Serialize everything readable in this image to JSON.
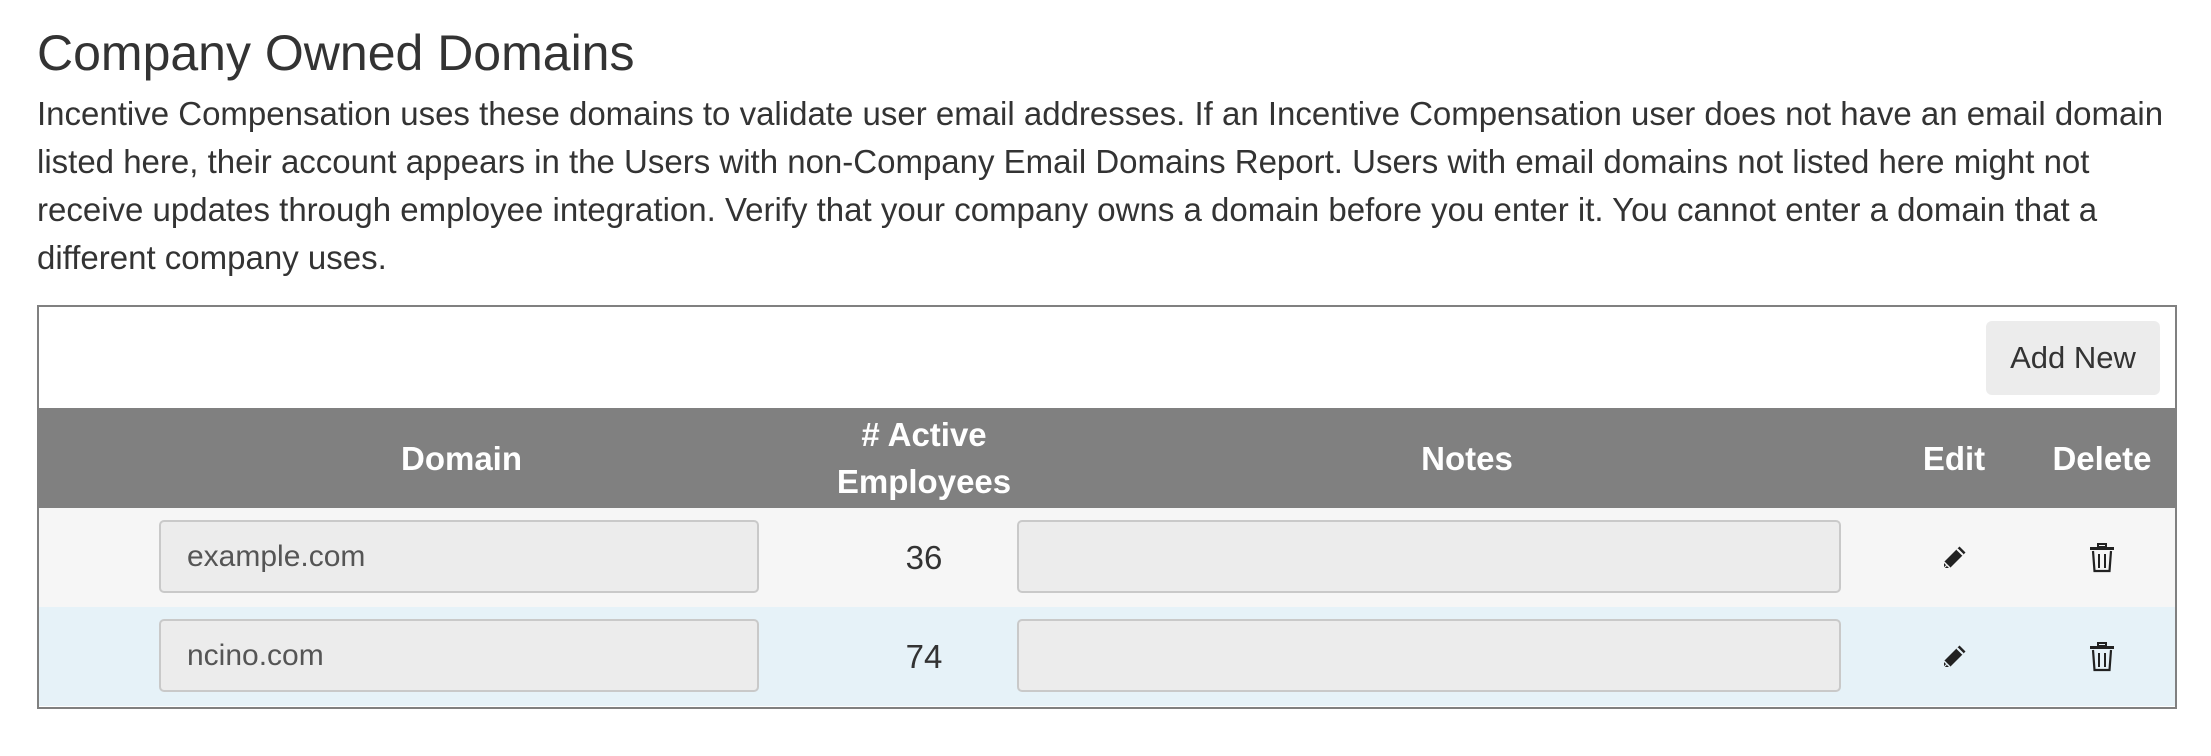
{
  "page": {
    "title": "Company Owned Domains",
    "description": "Incentive Compensation uses these domains to validate user email addresses. If an Incentive Compensation user does not have an email domain listed here, their account appears in the Users with non-Company Email Domains Report. Users with email domains not listed here might not receive updates through employee integration. Verify that your company owns a domain before you enter it. You cannot enter a domain that a different company uses."
  },
  "toolbar": {
    "add_new_label": "Add New"
  },
  "table": {
    "columns": {
      "domain": "Domain",
      "active_line1": "# Active",
      "active_line2": "Employees",
      "notes": "Notes",
      "edit": "Edit",
      "delete": "Delete"
    },
    "rows": [
      {
        "domain": "example.com",
        "active_employees": "36",
        "notes": "",
        "edit_icon": "pencil-icon",
        "delete_icon": "trash-icon"
      },
      {
        "domain": "ncino.com",
        "active_employees": "74",
        "notes": "",
        "edit_icon": "pencil-icon",
        "delete_icon": "trash-icon"
      }
    ]
  },
  "colors": {
    "header_background": "#808080",
    "row_alt_background": "#e6f2f8",
    "row_background": "#f6f6f6",
    "button_background": "#ececec"
  }
}
